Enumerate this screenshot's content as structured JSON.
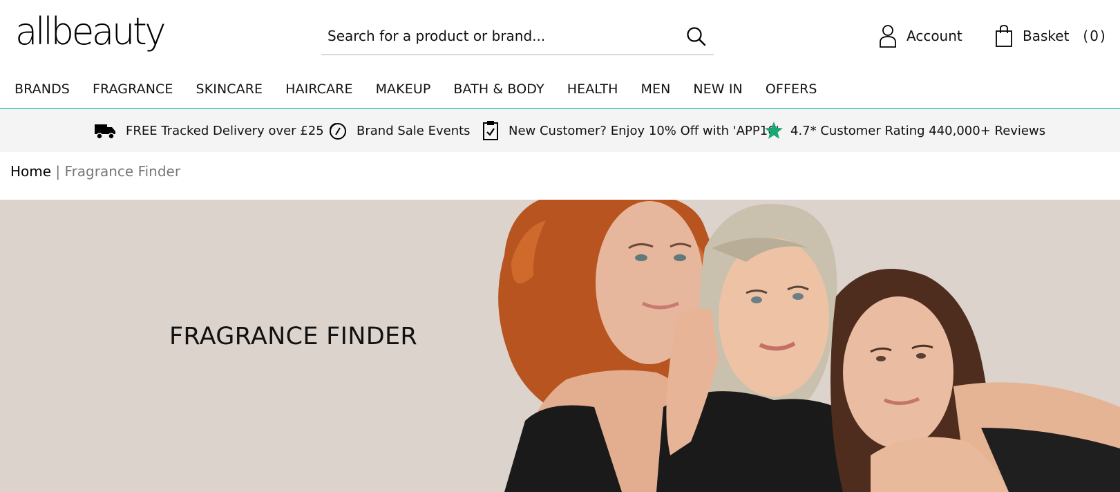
{
  "header": {
    "logo_text": "allbeauty",
    "search": {
      "placeholder": "Search for a product or brand...",
      "value": ""
    },
    "account_label": "Account",
    "basket_label": "Basket",
    "basket_count": "(0)"
  },
  "nav": {
    "items": [
      "BRANDS",
      "FRAGRANCE",
      "SKINCARE",
      "HAIRCARE",
      "MAKEUP",
      "BATH & BODY",
      "HEALTH",
      "MEN",
      "NEW IN",
      "OFFERS"
    ]
  },
  "promo": {
    "delivery": "FREE Tracked Delivery over £25",
    "sale": "Brand Sale Events",
    "new_customer": "New Customer? Enjoy 10% Off with 'APP10'",
    "rating": "4.7* Customer Rating 440,000+ Reviews"
  },
  "breadcrumb": {
    "home": "Home",
    "separator": "|",
    "current": "Fragrance Finder"
  },
  "hero": {
    "title": "FRAGRANCE FINDER",
    "image_alt": "three-women-portrait"
  },
  "colors": {
    "accent_line": "#6fcbc7",
    "promo_bg": "#f4f4f4",
    "hero_bg": "#dcd3cd",
    "star": "#1aa774"
  },
  "icons": [
    "search-icon",
    "user-icon",
    "basket-icon",
    "delivery-truck-icon",
    "sale-tag-icon",
    "clipboard-check-icon",
    "star-icon"
  ]
}
